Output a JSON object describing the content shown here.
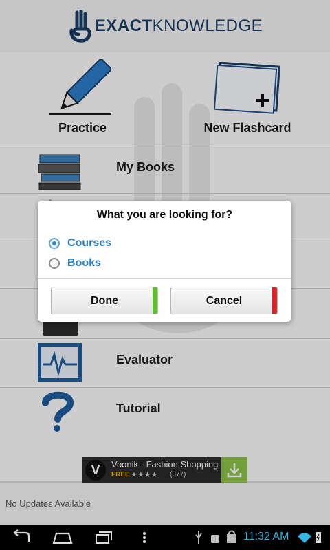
{
  "header": {
    "logo_bold": "EXACT",
    "logo_light": "KNOWLEDGE"
  },
  "quick_actions": [
    {
      "label": "Practice",
      "icon": "pencil-icon"
    },
    {
      "label": "New Flashcard",
      "icon": "flashcard-icon"
    }
  ],
  "menu": [
    {
      "label": "My Books",
      "icon": "books-icon"
    },
    {
      "label": "",
      "icon": "book-icon"
    },
    {
      "label": "",
      "icon": "item-icon"
    },
    {
      "label": "",
      "icon": "keyboard-icon"
    },
    {
      "label": "Evaluator",
      "icon": "monitor-pulse-icon"
    },
    {
      "label": "Tutorial",
      "icon": "question-mark-icon"
    }
  ],
  "ad": {
    "logo_letter": "V",
    "title": "Voonik - Fashion Shopping",
    "free": "FREE",
    "stars": "★★★★",
    "rating_count": "(377)",
    "rating_fraction": 0.8,
    "icon": "download-icon"
  },
  "updates": {
    "text": "No Updates Available"
  },
  "dialog": {
    "title": "What you are looking for?",
    "options": [
      {
        "label": "Courses",
        "selected": true
      },
      {
        "label": "Books",
        "selected": false
      }
    ],
    "done_label": "Done",
    "cancel_label": "Cancel",
    "done_accent": "#5cbf2a",
    "cancel_accent": "#d9232d"
  },
  "system_bar": {
    "time": "11:32 AM",
    "accent": "#33b5e5"
  }
}
